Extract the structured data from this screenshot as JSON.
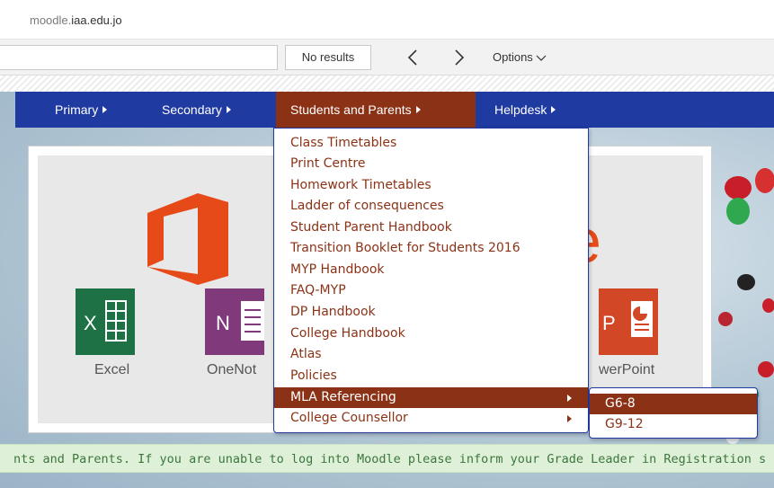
{
  "browser": {
    "address_host_prefix": "moodle.",
    "address_host_domain": "iaa.edu.jo"
  },
  "find_bar": {
    "input_value": "",
    "results_text": "No results",
    "options_label": "Options"
  },
  "nav": {
    "items": [
      {
        "label": "Primary"
      },
      {
        "label": "Secondary"
      },
      {
        "label": "Students and Parents"
      },
      {
        "label": "Helpdesk"
      }
    ],
    "active_color": "#8b3216",
    "bar_color": "#1f3aa0"
  },
  "panel": {
    "office_wordmark_fragment": "e",
    "apps": [
      {
        "label": "Excel",
        "letter": "X",
        "color": "#1e7145"
      },
      {
        "label": "OneNot",
        "letter": "N",
        "color": "#80397b"
      },
      {
        "label": "werPoint",
        "letter": "P",
        "color": "#d24726"
      }
    ]
  },
  "dropdown": {
    "items": [
      {
        "label": "Class Timetables"
      },
      {
        "label": "Print Centre"
      },
      {
        "label": "Homework Timetables"
      },
      {
        "label": "Ladder of consequences"
      },
      {
        "label": "Student Parent Handbook"
      },
      {
        "label": "Transition Booklet for Students 2016"
      },
      {
        "label": "MYP Handbook"
      },
      {
        "label": "FAQ-MYP"
      },
      {
        "label": "DP Handbook"
      },
      {
        "label": "College Handbook"
      },
      {
        "label": "Atlas"
      },
      {
        "label": "Policies"
      },
      {
        "label": "MLA Referencing"
      },
      {
        "label": "College Counsellor"
      }
    ],
    "submenu": [
      {
        "label": "G6-8"
      },
      {
        "label": "G9-12"
      }
    ]
  },
  "notice": {
    "text": "nts and Parents. If you are unable to log into Moodle please inform your Grade Leader in Registration s"
  }
}
